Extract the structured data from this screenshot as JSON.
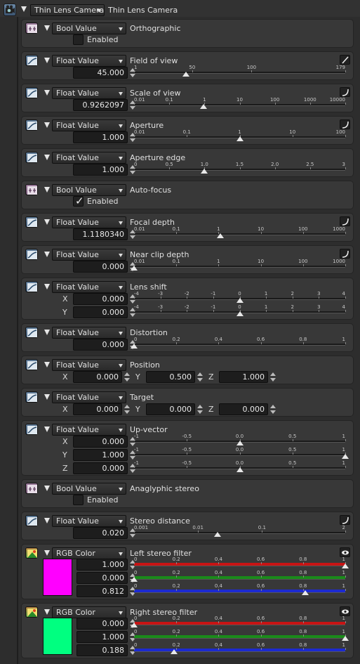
{
  "header": {
    "camera_type": "Thin Lens Camera",
    "title": "Thin Lens Camera"
  },
  "colors": {
    "left_swatch": "#ff00ff",
    "right_swatch": "#00ff80"
  },
  "panels": [
    {
      "key": "p0",
      "type": "Bool Value",
      "title": "Orthographic",
      "checkbox": {
        "checked": false,
        "label": "Enabled"
      }
    },
    {
      "key": "p1",
      "type": "Float Value",
      "title": "Field of view",
      "value": "45.000",
      "right_icon": "line-icon",
      "ticks": [
        "1",
        "50",
        "100",
        "179"
      ],
      "tick_values": [
        1,
        50,
        100,
        179
      ],
      "range": [
        1,
        179
      ],
      "scale": "linear",
      "thumb": 45
    },
    {
      "key": "p2",
      "type": "Float Value",
      "title": "Scale of view",
      "value": "0.9262097",
      "right_icon": "curve-icon",
      "ticks": [
        "0.01",
        "0.1",
        "1",
        "10",
        "100",
        "1000",
        "10000"
      ],
      "tick_values": [
        0.01,
        0.1,
        1,
        10,
        100,
        1000,
        10000
      ],
      "range": [
        0.01,
        10000
      ],
      "scale": "log",
      "thumb": 0.9262097
    },
    {
      "key": "p3",
      "type": "Float Value",
      "title": "Aperture",
      "value": "1.000",
      "right_icon": "curve-icon",
      "ticks": [
        "0.01",
        "0.1",
        "1",
        "10",
        "100"
      ],
      "tick_values": [
        0.01,
        0.1,
        1,
        10,
        100
      ],
      "range": [
        0.01,
        100
      ],
      "scale": "log",
      "thumb": 1
    },
    {
      "key": "p4",
      "type": "Float Value",
      "title": "Aperture edge",
      "value": "1.000",
      "ticks": [
        "0",
        "0.5",
        "1.0",
        "1.5",
        "2.0",
        "2.5",
        "3"
      ],
      "tick_values": [
        0,
        0.5,
        1,
        1.5,
        2,
        2.5,
        3
      ],
      "range": [
        0,
        3
      ],
      "scale": "linear",
      "thumb": 1
    },
    {
      "key": "p5",
      "type": "Bool Value",
      "title": "Auto-focus",
      "checkbox": {
        "checked": true,
        "label": "Enabled"
      }
    },
    {
      "key": "p6",
      "type": "Float Value",
      "title": "Focal depth",
      "value": "1.1180340",
      "right_icon": "curve-icon",
      "ticks": [
        "0.01",
        "0.1",
        "1",
        "10",
        "100",
        "1000"
      ],
      "tick_values": [
        0.01,
        0.1,
        1,
        10,
        100,
        1000
      ],
      "range": [
        0.01,
        1000
      ],
      "scale": "log",
      "thumb": 1.118034
    },
    {
      "key": "p7",
      "type": "Float Value",
      "title": "Near clip depth",
      "value": "0.000",
      "right_icon": "curve-icon",
      "ticks": [
        "0.01",
        "0.1",
        "1",
        "10",
        "100",
        "1000"
      ],
      "tick_values": [
        0.01,
        0.1,
        1,
        10,
        100,
        1000
      ],
      "range": [
        0.01,
        1000
      ],
      "scale": "log",
      "thumb": 0.01
    },
    {
      "key": "p8",
      "type": "Float Value",
      "title": "Lens shift",
      "rows": [
        {
          "axis": "X",
          "value": "0.000",
          "ticks": [
            "-4",
            "-3",
            "-2",
            "-1",
            "0",
            "1",
            "2",
            "3",
            "4"
          ],
          "tick_values": [
            -4,
            -3,
            -2,
            -1,
            0,
            1,
            2,
            3,
            4
          ],
          "range": [
            -4,
            4
          ],
          "scale": "linear",
          "thumb": 0
        },
        {
          "axis": "Y",
          "value": "0.000",
          "ticks": [
            "-4",
            "-3",
            "-2",
            "-1",
            "0",
            "1",
            "2",
            "3",
            "4"
          ],
          "tick_values": [
            -4,
            -3,
            -2,
            -1,
            0,
            1,
            2,
            3,
            4
          ],
          "range": [
            -4,
            4
          ],
          "scale": "linear",
          "thumb": 0
        }
      ]
    },
    {
      "key": "p9",
      "type": "Float Value",
      "title": "Distortion",
      "value": "0.000",
      "ticks": [
        "0",
        "0.2",
        "0.4",
        "0.6",
        "0.8",
        "1"
      ],
      "tick_values": [
        0,
        0.2,
        0.4,
        0.6,
        0.8,
        1
      ],
      "range": [
        0,
        1
      ],
      "scale": "linear",
      "thumb": 0
    },
    {
      "key": "p10",
      "type": "Float Value",
      "title": "Position",
      "xyz": [
        {
          "axis": "X",
          "value": "0.000"
        },
        {
          "axis": "Y",
          "value": "0.500"
        },
        {
          "axis": "Z",
          "value": "1.000"
        }
      ]
    },
    {
      "key": "p11",
      "type": "Float Value",
      "title": "Target",
      "xyz": [
        {
          "axis": "X",
          "value": "0.000"
        },
        {
          "axis": "Y",
          "value": "0.000"
        },
        {
          "axis": "Z",
          "value": "0.000"
        }
      ]
    },
    {
      "key": "p12",
      "type": "Float Value",
      "title": "Up-vector",
      "rows": [
        {
          "axis": "X",
          "value": "0.000",
          "ticks": [
            "-1",
            "-0.5",
            "0.0",
            "0.5",
            "1"
          ],
          "tick_values": [
            -1,
            -0.5,
            0,
            0.5,
            1
          ],
          "range": [
            -1,
            1
          ],
          "scale": "linear",
          "thumb": 0
        },
        {
          "axis": "Y",
          "value": "1.000",
          "ticks": [
            "-1",
            "-0.5",
            "0.0",
            "0.5",
            "1"
          ],
          "tick_values": [
            -1,
            -0.5,
            0,
            0.5,
            1
          ],
          "range": [
            -1,
            1
          ],
          "scale": "linear",
          "thumb": 1
        },
        {
          "axis": "Z",
          "value": "0.000",
          "ticks": [
            "-1",
            "-0.5",
            "0.0",
            "0.5",
            "1"
          ],
          "tick_values": [
            -1,
            -0.5,
            0,
            0.5,
            1
          ],
          "range": [
            -1,
            1
          ],
          "scale": "linear",
          "thumb": 0
        }
      ]
    },
    {
      "key": "p13",
      "type": "Bool Value",
      "title": "Anaglyphic stereo",
      "checkbox": {
        "checked": false,
        "label": "Enabled"
      }
    },
    {
      "key": "p14",
      "type": "Float Value",
      "title": "Stereo distance",
      "value": "0.020",
      "right_icon": "curve-icon",
      "ticks": [
        "0.001",
        "0.01",
        "0.1",
        "2"
      ],
      "tick_values": [
        0.001,
        0.01,
        0.1,
        2
      ],
      "range": [
        0.001,
        2
      ],
      "scale": "log",
      "thumb": 0.02
    },
    {
      "key": "p15",
      "type": "RGB Color",
      "title": "Left stereo filter",
      "right_icon": "eye-icon",
      "swatch": "left",
      "rows": [
        {
          "value": "1.000",
          "bar": "#c81414",
          "ticks": [
            "0",
            "0.2",
            "0.4",
            "0.6",
            "0.8",
            "1"
          ],
          "tick_values": [
            0,
            0.2,
            0.4,
            0.6,
            0.8,
            1
          ],
          "range": [
            0,
            1
          ],
          "scale": "linear",
          "thumb": 1
        },
        {
          "value": "0.000",
          "bar": "#1a8a1a",
          "ticks": [
            "0",
            "0.2",
            "0.4",
            "0.6",
            "0.8",
            "1"
          ],
          "tick_values": [
            0,
            0.2,
            0.4,
            0.6,
            0.8,
            1
          ],
          "range": [
            0,
            1
          ],
          "scale": "linear",
          "thumb": 0
        },
        {
          "value": "0.812",
          "bar": "#1c2ad0",
          "ticks": [
            "0",
            "0.2",
            "0.4",
            "0.6",
            "0.8",
            "1"
          ],
          "tick_values": [
            0,
            0.2,
            0.4,
            0.6,
            0.8,
            1
          ],
          "range": [
            0,
            1
          ],
          "scale": "linear",
          "thumb": 0.812
        }
      ]
    },
    {
      "key": "p16",
      "type": "RGB Color",
      "title": "Right stereo filter",
      "right_icon": "eye-icon",
      "swatch": "right",
      "rows": [
        {
          "value": "0.000",
          "bar": "#c81414",
          "ticks": [
            "0",
            "0.2",
            "0.4",
            "0.6",
            "0.8",
            "1"
          ],
          "tick_values": [
            0,
            0.2,
            0.4,
            0.6,
            0.8,
            1
          ],
          "range": [
            0,
            1
          ],
          "scale": "linear",
          "thumb": 0
        },
        {
          "value": "1.000",
          "bar": "#1a8a1a",
          "ticks": [
            "0",
            "0.2",
            "0.4",
            "0.6",
            "0.8",
            "1"
          ],
          "tick_values": [
            0,
            0.2,
            0.4,
            0.6,
            0.8,
            1
          ],
          "range": [
            0,
            1
          ],
          "scale": "linear",
          "thumb": 1
        },
        {
          "value": "0.188",
          "bar": "#1c2ad0",
          "ticks": [
            "0",
            "0.2",
            "0.4",
            "0.6",
            "0.8",
            "1"
          ],
          "tick_values": [
            0,
            0.2,
            0.4,
            0.6,
            0.8,
            1
          ],
          "range": [
            0,
            1
          ],
          "scale": "linear",
          "thumb": 0.188
        }
      ]
    }
  ]
}
